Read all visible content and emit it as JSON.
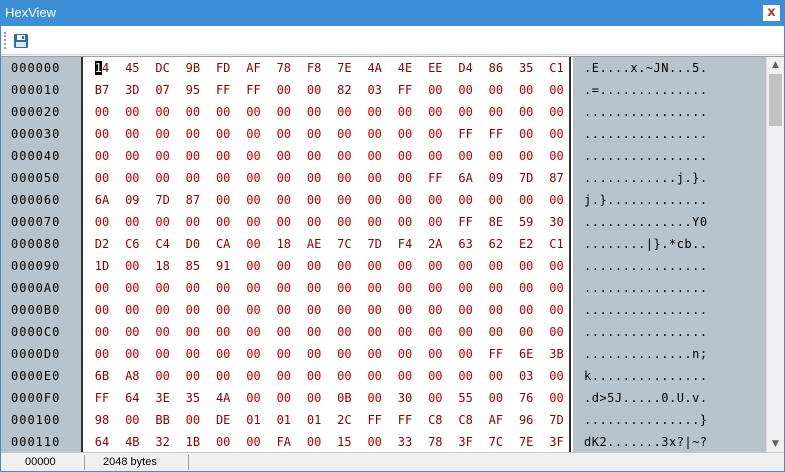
{
  "window": {
    "title": "HexView",
    "close_glyph": "x"
  },
  "toolbar": {
    "save_icon": "save-icon"
  },
  "colors": {
    "accent": "#3c8fd6",
    "panel": "#b7c4ce",
    "byte_text": "#c00000",
    "cursor": "#000000"
  },
  "rows": [
    {
      "address": "000000",
      "bytes": [
        "14",
        "45",
        "DC",
        "9B",
        "FD",
        "AF",
        "78",
        "F8",
        "7E",
        "4A",
        "4E",
        "EE",
        "D4",
        "86",
        "35",
        "C1"
      ],
      "ascii": ".E....x.~JN...5."
    },
    {
      "address": "000010",
      "bytes": [
        "B7",
        "3D",
        "07",
        "95",
        "FF",
        "FF",
        "00",
        "00",
        "82",
        "03",
        "FF",
        "00",
        "00",
        "00",
        "00",
        "00"
      ],
      "ascii": ".=.............."
    },
    {
      "address": "000020",
      "bytes": [
        "00",
        "00",
        "00",
        "00",
        "00",
        "00",
        "00",
        "00",
        "00",
        "00",
        "00",
        "00",
        "00",
        "00",
        "00",
        "00"
      ],
      "ascii": "................"
    },
    {
      "address": "000030",
      "bytes": [
        "00",
        "00",
        "00",
        "00",
        "00",
        "00",
        "00",
        "00",
        "00",
        "00",
        "00",
        "00",
        "FF",
        "FF",
        "00",
        "00"
      ],
      "ascii": "................"
    },
    {
      "address": "000040",
      "bytes": [
        "00",
        "00",
        "00",
        "00",
        "00",
        "00",
        "00",
        "00",
        "00",
        "00",
        "00",
        "00",
        "00",
        "00",
        "00",
        "00"
      ],
      "ascii": "................"
    },
    {
      "address": "000050",
      "bytes": [
        "00",
        "00",
        "00",
        "00",
        "00",
        "00",
        "00",
        "00",
        "00",
        "00",
        "00",
        "FF",
        "6A",
        "09",
        "7D",
        "87"
      ],
      "ascii": "............j.}."
    },
    {
      "address": "000060",
      "bytes": [
        "6A",
        "09",
        "7D",
        "87",
        "00",
        "00",
        "00",
        "00",
        "00",
        "00",
        "00",
        "00",
        "00",
        "00",
        "00",
        "00"
      ],
      "ascii": "j.}............."
    },
    {
      "address": "000070",
      "bytes": [
        "00",
        "00",
        "00",
        "00",
        "00",
        "00",
        "00",
        "00",
        "00",
        "00",
        "00",
        "00",
        "FF",
        "8E",
        "59",
        "30"
      ],
      "ascii": "..............Y0"
    },
    {
      "address": "000080",
      "bytes": [
        "D2",
        "C6",
        "C4",
        "D0",
        "CA",
        "00",
        "18",
        "AE",
        "7C",
        "7D",
        "F4",
        "2A",
        "63",
        "62",
        "E2",
        "C1"
      ],
      "ascii": "........|}.*cb.."
    },
    {
      "address": "000090",
      "bytes": [
        "1D",
        "00",
        "18",
        "85",
        "91",
        "00",
        "00",
        "00",
        "00",
        "00",
        "00",
        "00",
        "00",
        "00",
        "00",
        "00"
      ],
      "ascii": "................"
    },
    {
      "address": "0000A0",
      "bytes": [
        "00",
        "00",
        "00",
        "00",
        "00",
        "00",
        "00",
        "00",
        "00",
        "00",
        "00",
        "00",
        "00",
        "00",
        "00",
        "00"
      ],
      "ascii": "................"
    },
    {
      "address": "0000B0",
      "bytes": [
        "00",
        "00",
        "00",
        "00",
        "00",
        "00",
        "00",
        "00",
        "00",
        "00",
        "00",
        "00",
        "00",
        "00",
        "00",
        "00"
      ],
      "ascii": "................"
    },
    {
      "address": "0000C0",
      "bytes": [
        "00",
        "00",
        "00",
        "00",
        "00",
        "00",
        "00",
        "00",
        "00",
        "00",
        "00",
        "00",
        "00",
        "00",
        "00",
        "00"
      ],
      "ascii": "................"
    },
    {
      "address": "0000D0",
      "bytes": [
        "00",
        "00",
        "00",
        "00",
        "00",
        "00",
        "00",
        "00",
        "00",
        "00",
        "00",
        "00",
        "00",
        "FF",
        "6E",
        "3B"
      ],
      "ascii": "..............n;"
    },
    {
      "address": "0000E0",
      "bytes": [
        "6B",
        "A8",
        "00",
        "00",
        "00",
        "00",
        "00",
        "00",
        "00",
        "00",
        "00",
        "00",
        "00",
        "00",
        "03",
        "00"
      ],
      "ascii": "k..............."
    },
    {
      "address": "0000F0",
      "bytes": [
        "FF",
        "64",
        "3E",
        "35",
        "4A",
        "00",
        "00",
        "00",
        "0B",
        "00",
        "30",
        "00",
        "55",
        "00",
        "76",
        "00"
      ],
      "ascii": ".d>5J.....0.U.v."
    },
    {
      "address": "000100",
      "bytes": [
        "98",
        "00",
        "BB",
        "00",
        "DE",
        "01",
        "01",
        "01",
        "2C",
        "FF",
        "FF",
        "C8",
        "C8",
        "AF",
        "96",
        "7D"
      ],
      "ascii": "...............}"
    },
    {
      "address": "000110",
      "bytes": [
        "64",
        "4B",
        "32",
        "1B",
        "00",
        "00",
        "FA",
        "00",
        "15",
        "00",
        "33",
        "78",
        "3F",
        "7C",
        "7E",
        "3F"
      ],
      "ascii": "dK2.......3x?|~?"
    }
  ],
  "status": {
    "offset": "00000",
    "size": "2048 bytes"
  }
}
